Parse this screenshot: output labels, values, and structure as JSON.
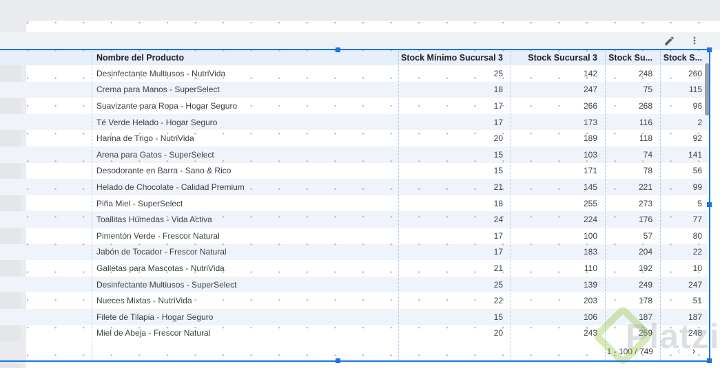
{
  "toolbar": {
    "edit_icon": "pencil-icon",
    "more_icon": "kebab-menu-icon"
  },
  "table": {
    "columns": [
      {
        "label": "Nombre del Producto",
        "align": "left"
      },
      {
        "label": "Stock Mínimo Sucursal 3",
        "align": "right"
      },
      {
        "label": "Stock Sucursal 3",
        "align": "right"
      },
      {
        "label": "Stock Su...",
        "align": "right"
      },
      {
        "label": "Stock S...",
        "align": "right"
      }
    ],
    "rows": [
      [
        "Desinfectante Multiusos - NutriVida",
        "25",
        "142",
        "248",
        "260"
      ],
      [
        "Crema para Manos - SuperSelect",
        "18",
        "247",
        "75",
        "115"
      ],
      [
        "Suavizante para Ropa - Hogar Seguro",
        "17",
        "266",
        "268",
        "96"
      ],
      [
        "Té Verde Helado - Hogar Seguro",
        "17",
        "173",
        "116",
        "2"
      ],
      [
        "Harina de Trigo - NutriVida",
        "20",
        "189",
        "118",
        "92"
      ],
      [
        "Arena para Gatos - SuperSelect",
        "15",
        "103",
        "74",
        "141"
      ],
      [
        "Desodorante en Barra - Sano & Rico",
        "15",
        "171",
        "78",
        "56"
      ],
      [
        "Helado de Chocolate - Calidad Premium",
        "21",
        "145",
        "221",
        "99"
      ],
      [
        "Piña Miel - SuperSelect",
        "18",
        "255",
        "273",
        "5"
      ],
      [
        "Toallitas Húmedas - Vida Activa",
        "24",
        "224",
        "176",
        "77"
      ],
      [
        "Pimentón Verde - Frescor Natural",
        "17",
        "100",
        "57",
        "80"
      ],
      [
        "Jabón de Tocador - Frescor Natural",
        "17",
        "183",
        "204",
        "22"
      ],
      [
        "Galletas para Mascotas - NutriVida",
        "21",
        "110",
        "192",
        "10"
      ],
      [
        "Desinfectante Multiusos - SuperSelect",
        "25",
        "139",
        "249",
        "247"
      ],
      [
        "Nueces Mixtas - NutriVida",
        "22",
        "203",
        "178",
        "51"
      ],
      [
        "Filete de Tilapia - Hogar Seguro",
        "15",
        "106",
        "187",
        "187"
      ],
      [
        "Miel de Abeja - Frescor Natural",
        "20",
        "243",
        "259",
        "248"
      ]
    ]
  },
  "pagination": {
    "range_label": "1 - 100 / 749",
    "prev_icon": "chevron-left-icon",
    "next_icon": "chevron-right-icon"
  },
  "watermark": {
    "text": "Platzi"
  },
  "colors": {
    "accent": "#1a73e8",
    "header_bg": "#e6effa",
    "stripe": "#eff4fa",
    "icon_gray": "#5f6368"
  }
}
